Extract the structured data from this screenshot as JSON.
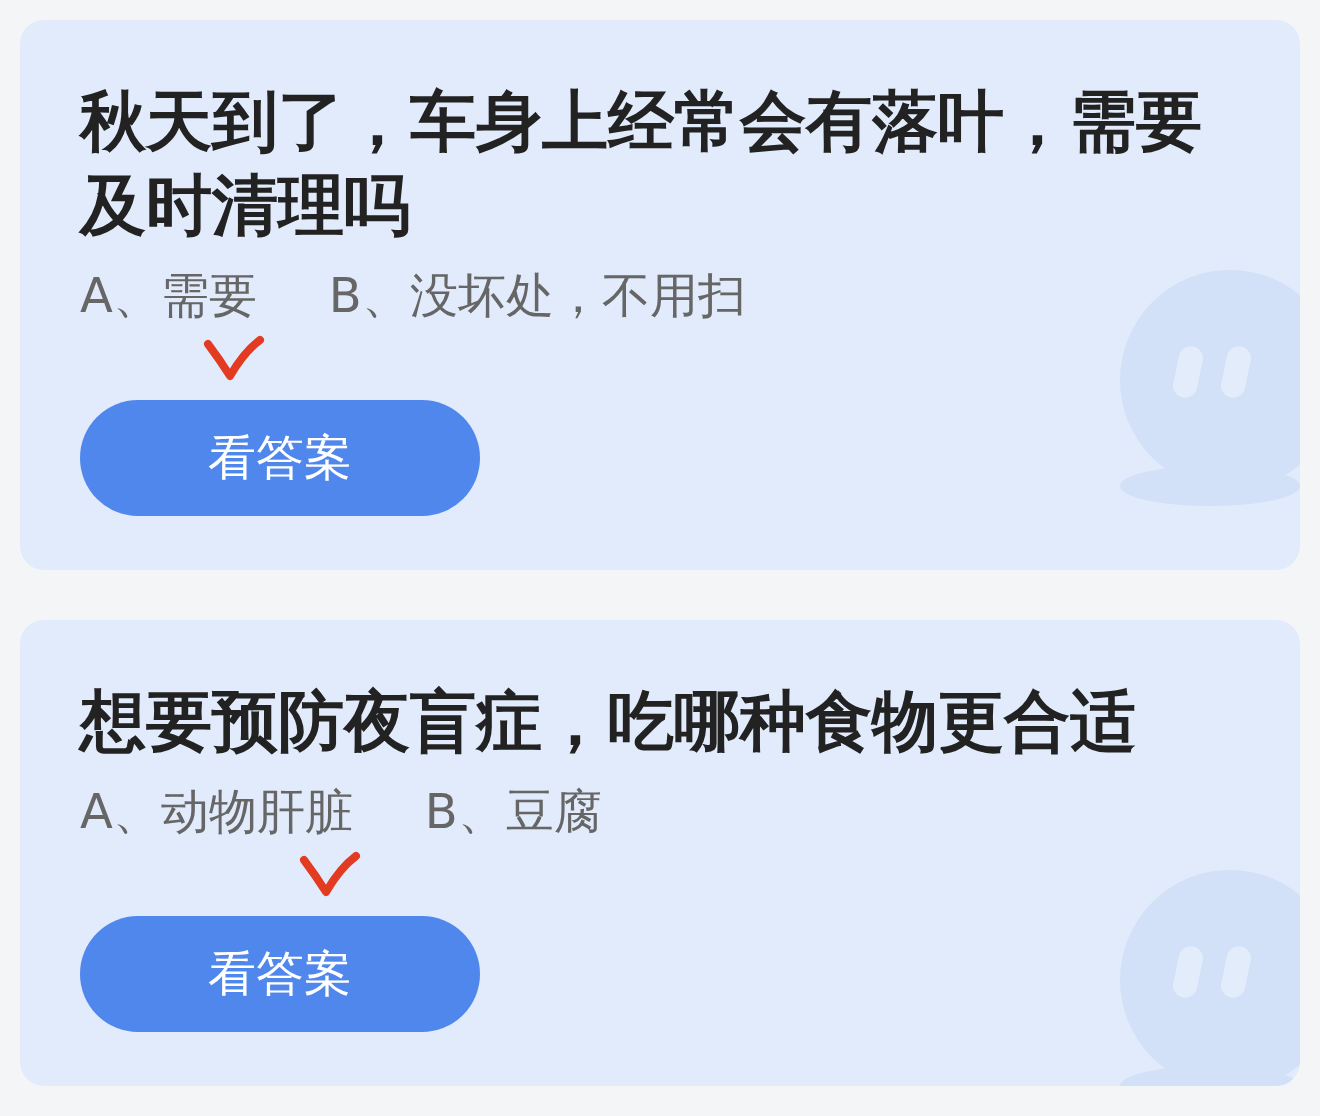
{
  "questions": [
    {
      "title": "秋天到了，车身上经常会有落叶，需要及时清理吗",
      "options": [
        {
          "text": "A、需要",
          "correct": true
        },
        {
          "text": "B、没坏处，不用扫",
          "correct": false
        }
      ],
      "button": "看答案"
    },
    {
      "title": "想要预防夜盲症，吃哪种食物更合适",
      "options": [
        {
          "text": "A、动物肝脏",
          "correct": true
        },
        {
          "text": "B、豆腐",
          "correct": false
        }
      ],
      "button": "看答案"
    }
  ]
}
